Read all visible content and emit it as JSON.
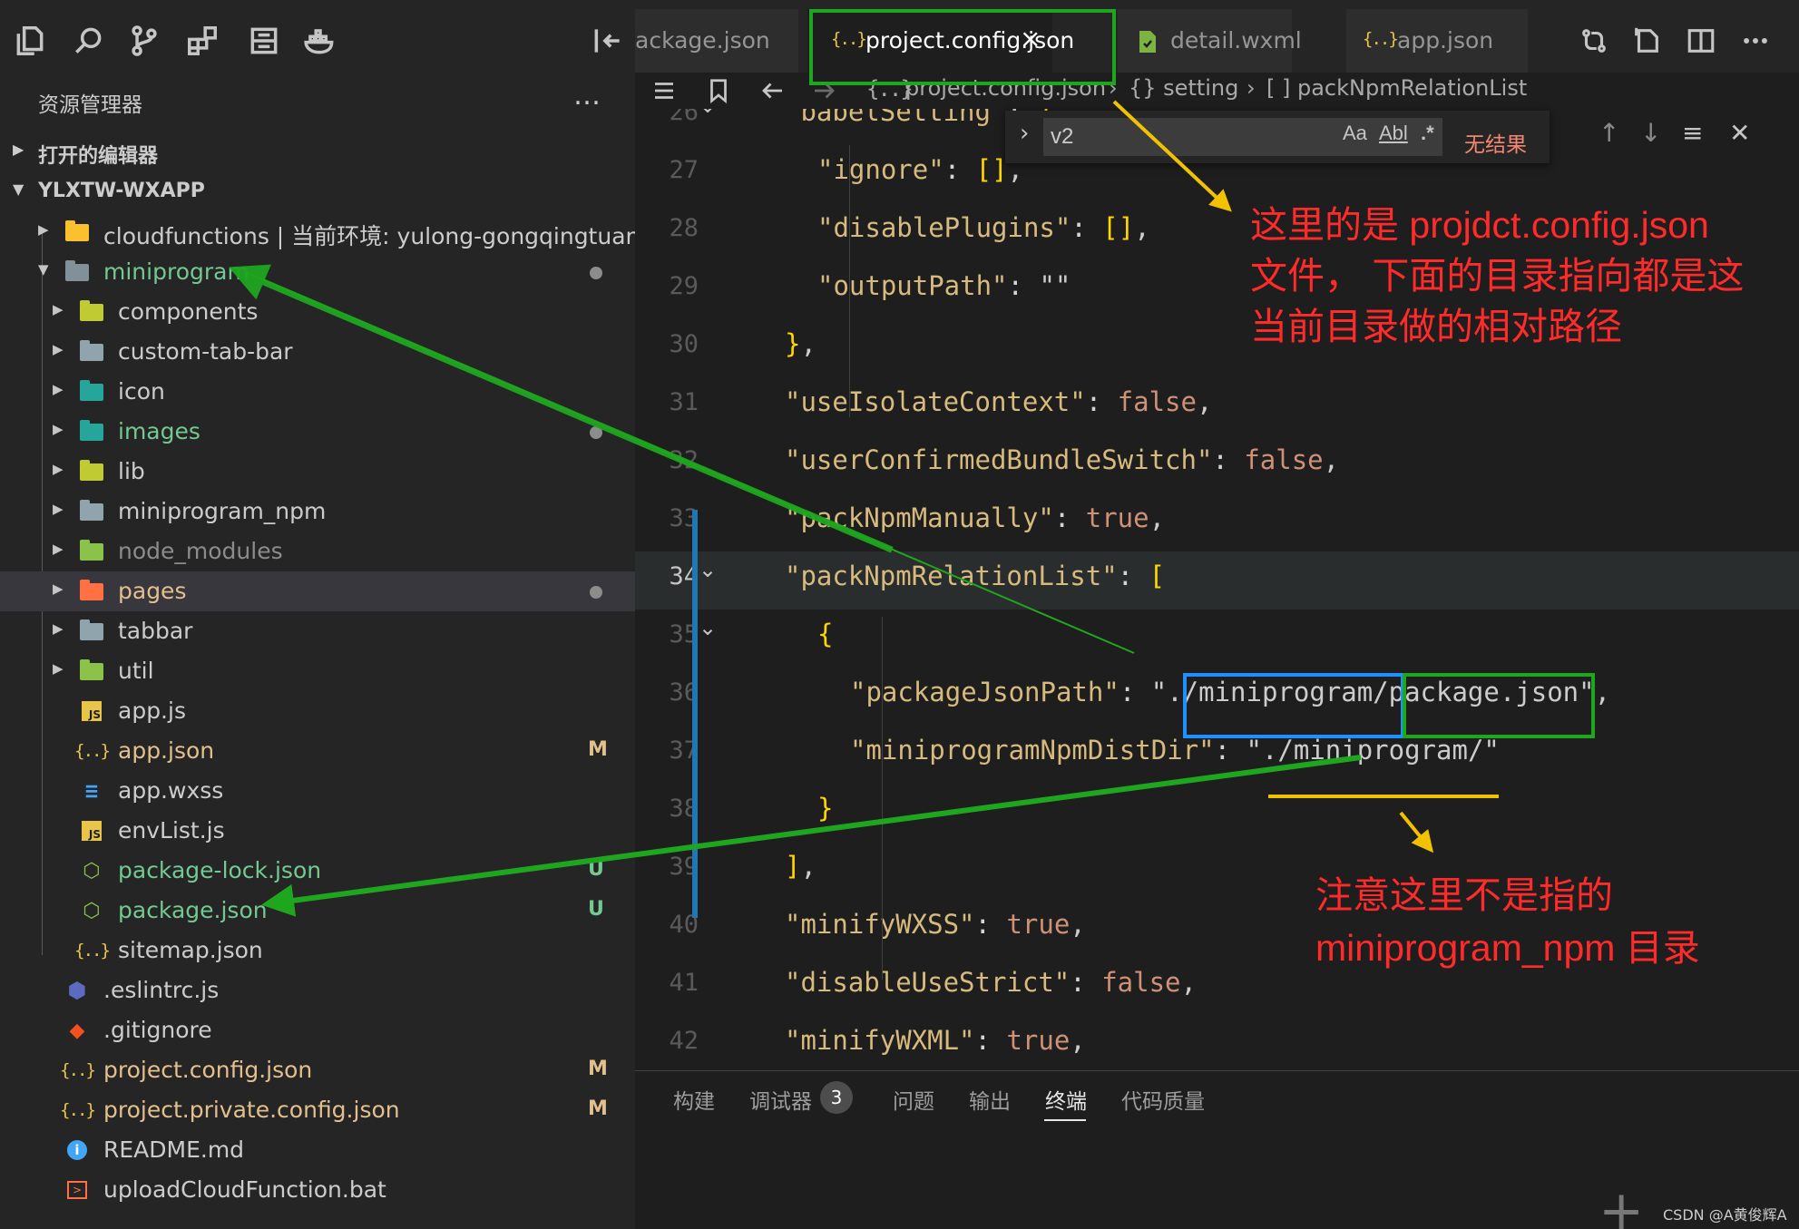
{
  "sidebar": {
    "title": "资源管理器",
    "more": "…",
    "sections": [
      {
        "label": "打开的编辑器",
        "expanded": false
      },
      {
        "label": "YLXTW-WXAPP",
        "expanded": true
      }
    ],
    "tree": [
      {
        "name": "cloudfunctions | 当前环境: yulong-gongqingtuan",
        "type": "folder-cloud",
        "color": "#cccccc",
        "expanded": false
      },
      {
        "name": "miniprogram",
        "type": "folder-open",
        "color": "#73c991",
        "expanded": true,
        "dot": true
      },
      {
        "name": "components",
        "type": "folder-comp",
        "color": "#cccccc",
        "expanded": false
      },
      {
        "name": "custom-tab-bar",
        "type": "folder",
        "color": "#cccccc",
        "expanded": false
      },
      {
        "name": "icon",
        "type": "folder-img",
        "color": "#cccccc",
        "expanded": false
      },
      {
        "name": "images",
        "type": "folder-img",
        "color": "#73c991",
        "expanded": false,
        "dot": true
      },
      {
        "name": "lib",
        "type": "folder-lib",
        "color": "#cccccc",
        "expanded": false
      },
      {
        "name": "miniprogram_npm",
        "type": "folder",
        "color": "#cccccc",
        "expanded": false
      },
      {
        "name": "node_modules",
        "type": "folder-node",
        "color": "#8c8c8c",
        "expanded": false
      },
      {
        "name": "pages",
        "type": "folder-pages",
        "color": "#e2c08d",
        "expanded": false,
        "dot": true
      },
      {
        "name": "tabbar",
        "type": "folder",
        "color": "#cccccc",
        "expanded": false
      },
      {
        "name": "util",
        "type": "folder-util",
        "color": "#cccccc",
        "expanded": false
      },
      {
        "name": "app.js",
        "type": "js",
        "color": "#cccccc"
      },
      {
        "name": "app.json",
        "type": "json",
        "color": "#e2c08d",
        "badge": "M"
      },
      {
        "name": "app.wxss",
        "type": "css",
        "color": "#cccccc"
      },
      {
        "name": "envList.js",
        "type": "js",
        "color": "#cccccc"
      },
      {
        "name": "package-lock.json",
        "type": "nodejs",
        "color": "#73c991",
        "badge": "U"
      },
      {
        "name": "package.json",
        "type": "nodejs",
        "color": "#73c991",
        "badge": "U"
      },
      {
        "name": "sitemap.json",
        "type": "json",
        "color": "#cccccc"
      },
      {
        "name": ".eslintrc.js",
        "type": "eslint",
        "color": "#cccccc"
      },
      {
        "name": ".gitignore",
        "type": "git",
        "color": "#cccccc"
      },
      {
        "name": "project.config.json",
        "type": "json",
        "color": "#e2c08d",
        "badge": "M"
      },
      {
        "name": "project.private.config.json",
        "type": "json",
        "color": "#e2c08d",
        "badge": "M"
      },
      {
        "name": "README.md",
        "type": "info",
        "color": "#cccccc"
      },
      {
        "name": "uploadCloudFunction.bat",
        "type": "bat",
        "color": "#cccccc"
      }
    ]
  },
  "tabs": [
    {
      "label": "ackage.json",
      "active": false
    },
    {
      "label": "project.config.json",
      "active": true
    },
    {
      "label": "detail.wxml",
      "active": false
    },
    {
      "label": "app.json",
      "active": false
    }
  ],
  "breadcrumb": {
    "file": "project.config.json",
    "p1": "{} setting",
    "p2": "[ ] packNpmRelationList"
  },
  "find": {
    "value": "v2",
    "opt_case": "Aa",
    "opt_word": "Abl",
    "opt_regex": ".*",
    "result": "无结果"
  },
  "code_lines": [
    {
      "num": "26",
      "text": "\"babelSetting\": {"
    },
    {
      "num": "27",
      "text": "\"ignore\": [],"
    },
    {
      "num": "28",
      "text": "\"disablePlugins\": [],"
    },
    {
      "num": "29",
      "text": "\"outputPath\": \"\""
    },
    {
      "num": "30",
      "text": "},"
    },
    {
      "num": "31",
      "text": "\"useIsolateContext\": false,"
    },
    {
      "num": "32",
      "text": "\"userConfirmedBundleSwitch\": false,"
    },
    {
      "num": "33",
      "text": "\"packNpmManually\": true,"
    },
    {
      "num": "34",
      "text": "\"packNpmRelationList\": ["
    },
    {
      "num": "35",
      "text": "{"
    },
    {
      "num": "36",
      "text": "\"packageJsonPath\": \"./miniprogram/package.json\","
    },
    {
      "num": "37",
      "text": "\"miniprogramNpmDistDir\": \"./miniprogram/\""
    },
    {
      "num": "38",
      "text": "}"
    },
    {
      "num": "39",
      "text": "],"
    },
    {
      "num": "40",
      "text": "\"minifyWXSS\": true,"
    },
    {
      "num": "41",
      "text": "\"disableUseStrict\": false,"
    },
    {
      "num": "42",
      "text": "\"minifyWXML\": true,"
    }
  ],
  "panel": {
    "tabs": [
      "构建",
      "调试器",
      "问题",
      "输出",
      "终端",
      "代码质量"
    ],
    "active": "终端",
    "badge": "3"
  },
  "annotations": {
    "note1": [
      "这里的是 projdct.config.json",
      "文件，  下面的目录指向都是这",
      "当前目录做的相对路径"
    ],
    "note2": [
      "注意这里不是指的",
      "miniprogram_npm 目录"
    ]
  },
  "watermark": "CSDN @A黄俊辉A",
  "colors": {
    "annotation_red": "#ff2a2a",
    "arrow_green": "#1fa61f",
    "arrow_yellow": "#f2c200",
    "box_blue": "#1e90ff"
  }
}
